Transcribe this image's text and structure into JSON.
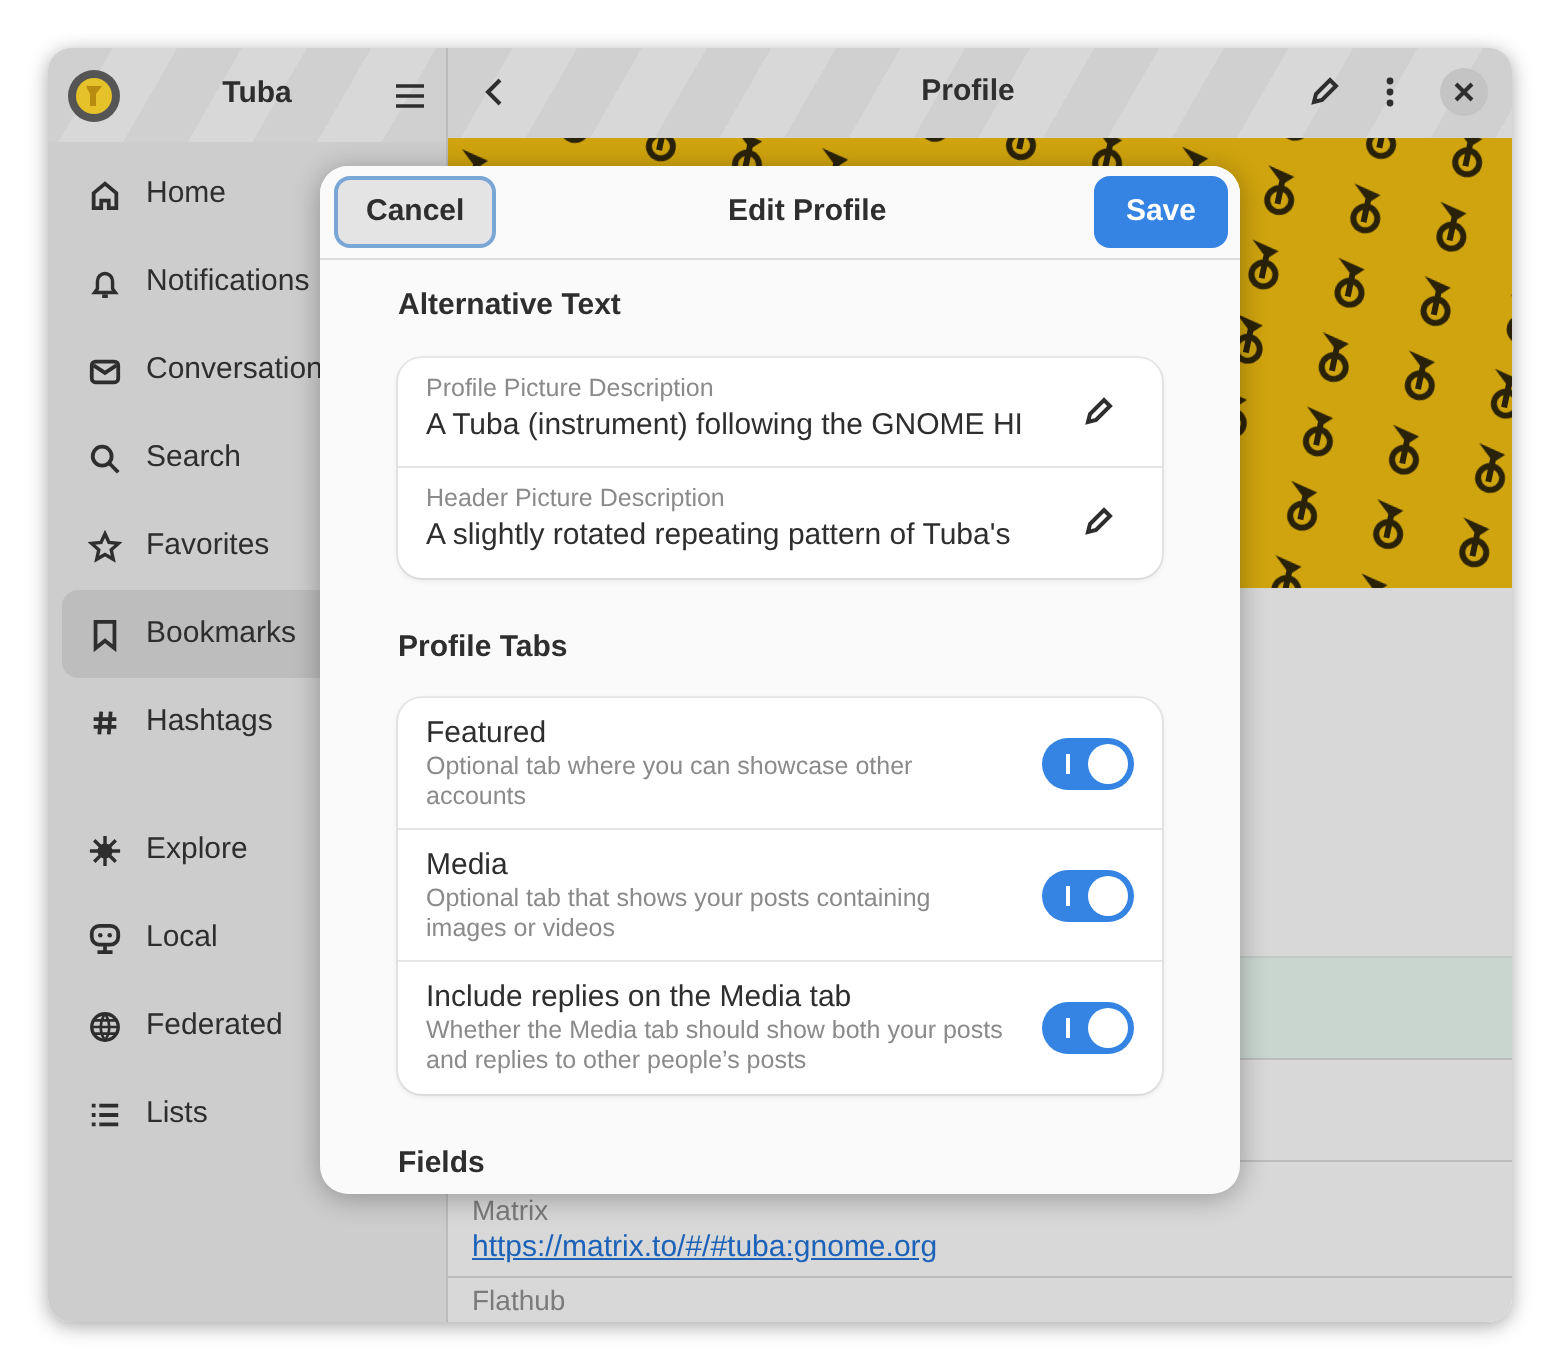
{
  "sidebar": {
    "title": "Tuba",
    "groups": [
      {
        "items": [
          {
            "label": "Home",
            "selected": false
          },
          {
            "label": "Notifications",
            "selected": false
          },
          {
            "label": "Conversation",
            "selected": false
          },
          {
            "label": "Search",
            "selected": false
          },
          {
            "label": "Favorites",
            "selected": false
          },
          {
            "label": "Bookmarks",
            "selected": true
          },
          {
            "label": "Hashtags",
            "selected": false
          }
        ]
      },
      {
        "items": [
          {
            "label": "Explore",
            "selected": false
          },
          {
            "label": "Local",
            "selected": false
          },
          {
            "label": "Federated",
            "selected": false
          },
          {
            "label": "Lists",
            "selected": false
          }
        ]
      }
    ]
  },
  "main": {
    "title": "Profile",
    "fields": [
      {
        "label": "Matrix",
        "value": "https://matrix.to/#/#tuba:gnome.org"
      },
      {
        "label": "Flathub"
      }
    ]
  },
  "dialog": {
    "title": "Edit Profile",
    "cancel": "Cancel",
    "save": "Save",
    "sections": [
      {
        "heading": "Alternative Text",
        "kind": "entries",
        "rows": [
          {
            "label": "Profile Picture Description",
            "value": "A Tuba (instrument) following the GNOME HI"
          },
          {
            "label": "Header Picture Description",
            "value": "A slightly rotated repeating pattern of Tuba's"
          }
        ]
      },
      {
        "heading": "Profile Tabs",
        "kind": "switches",
        "rows": [
          {
            "label": "Featured",
            "description": "Optional tab where you can showcase other accounts",
            "on": true
          },
          {
            "label": "Media",
            "description": "Optional tab that shows your posts containing images or videos",
            "on": true
          },
          {
            "label": "Include replies on the Media tab",
            "description": "Whether the Media tab should show both your posts and replies to other people’s posts",
            "on": true
          }
        ]
      },
      {
        "heading": "Fields",
        "kind": "heading"
      }
    ]
  }
}
